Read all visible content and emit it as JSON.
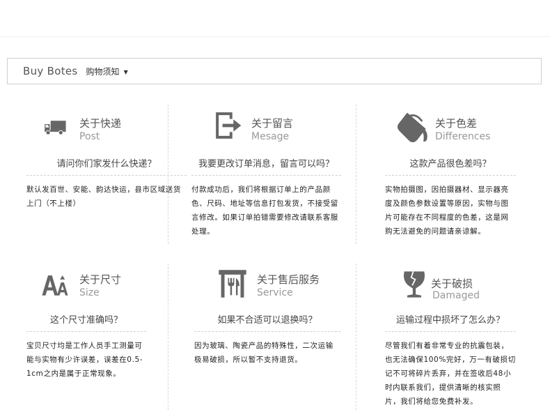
{
  "header": {
    "en": "Buy Botes",
    "cn": "购物须知",
    "caret": "▼"
  },
  "cards": [
    {
      "title": "关于快递",
      "sub": "Post",
      "question": "请问你们家发什么快递？",
      "answer": "默认发百世、安能、韵达快运，县市区域送货上门（不上楼）",
      "icon": "truck-icon"
    },
    {
      "title": "关于留言",
      "sub": "Mesage",
      "question": "我要更改订单消息，留言可以吗？",
      "answer": "付款成功后，我们将根据订单上的产品颜色、尺码、地址等信息打包发货，不接受留言修改。如果订单拍错需要修改请联系客服处理。",
      "icon": "exit-arrow-icon"
    },
    {
      "title": "关于色差",
      "sub": "Differences",
      "question": "这款产品很色差吗？",
      "answer": "实物拍摄图，因拍摄器材、显示器亮度及颜色参数设置等原因，实物与图片可能存在不同程度的色差，这是网购无法避免的问题请亲谅解。",
      "icon": "paint-bucket-icon"
    },
    {
      "title": "关于尺寸",
      "sub": "Size",
      "question": "这个尺寸准确吗？",
      "answer": "宝贝尺寸均是工作人员手工测量可能与实物有少许误差，误差在0.5-1cm之内是属于正常现象。",
      "icon": "font-size-icon"
    },
    {
      "title": "关于售后服务",
      "sub": "Service",
      "question": "如果不合适可以退换吗？",
      "answer": "因为玻璃、陶瓷产品的特殊性，二次运输极易破损，所以暂不支持退货。",
      "icon": "restaurant-service-icon"
    },
    {
      "title": "关于破损",
      "sub": "Damaged",
      "question": "运输过程中损坏了怎么办？",
      "answer": "尽管我们有着非常专业的抗震包装，也无法确保100%完好，万一有破损切记不可将碎片丢弃，并在签收后48小时内联系我们，提供清晰的核实照片，我们将给您免费补发。",
      "icon": "broken-glass-icon"
    }
  ]
}
